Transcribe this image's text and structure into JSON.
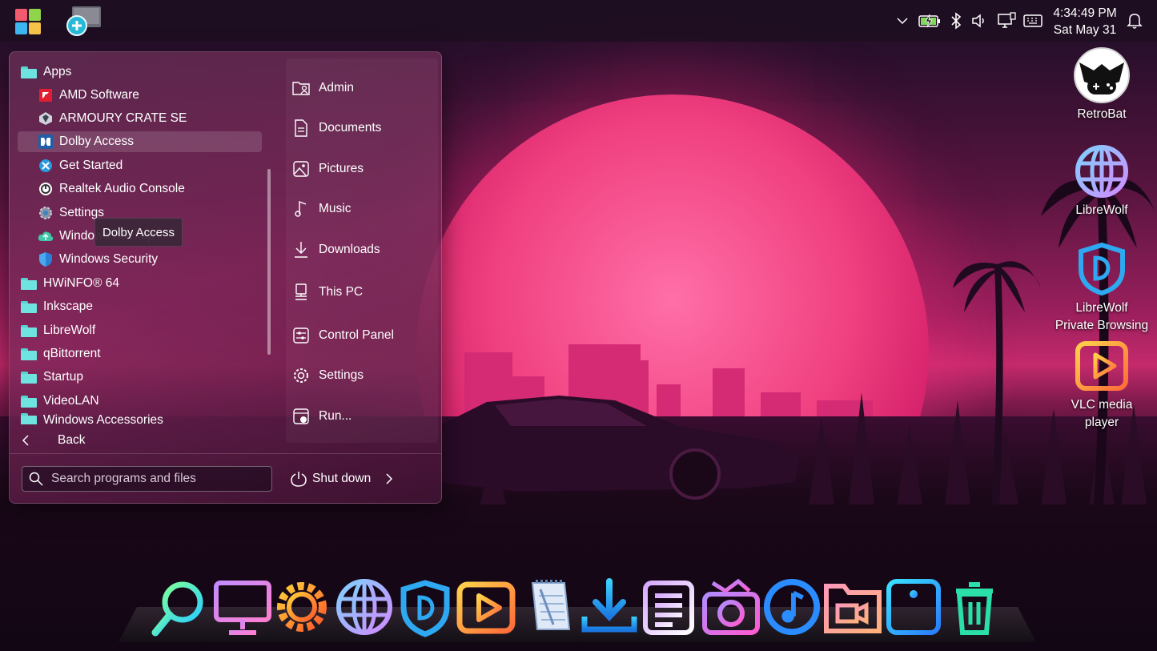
{
  "taskbar": {
    "start_icon": "windows-logo-icon",
    "pinned_app_icon": "magnifier-app-icon",
    "tray_icons": [
      "chevron-up-icon",
      "battery-charging-icon",
      "bluetooth-icon",
      "volume-icon",
      "display-icon",
      "keyboard-icon"
    ],
    "clock": {
      "time": "4:34:49 PM",
      "date": "Sat May 31"
    },
    "notification_icon": "bell-icon"
  },
  "start_menu": {
    "tree": [
      {
        "type": "folder",
        "label": "Apps"
      },
      {
        "type": "app",
        "label": "AMD Software",
        "icon": "amd-icon"
      },
      {
        "type": "app",
        "label": "ARMOURY CRATE SE",
        "icon": "armoury-crate-icon"
      },
      {
        "type": "app",
        "label": "Dolby Access",
        "icon": "dolby-icon",
        "selected": true
      },
      {
        "type": "app",
        "label": "Get Started",
        "icon": "get-started-icon"
      },
      {
        "type": "app",
        "label": "Realtek Audio Console",
        "icon": "realtek-icon"
      },
      {
        "type": "app",
        "label": "Settings",
        "icon": "settings-gear-icon"
      },
      {
        "type": "app",
        "label": "Windows Backup",
        "icon": "backup-cloud-icon"
      },
      {
        "type": "app",
        "label": "Windows Security",
        "icon": "shield-icon"
      },
      {
        "type": "folder",
        "label": "HWiNFO® 64"
      },
      {
        "type": "folder",
        "label": "Inkscape"
      },
      {
        "type": "folder",
        "label": "LibreWolf"
      },
      {
        "type": "folder",
        "label": "qBittorrent"
      },
      {
        "type": "folder",
        "label": "Startup"
      },
      {
        "type": "folder",
        "label": "VideoLAN"
      },
      {
        "type": "folder",
        "label": "Windows Accessories"
      }
    ],
    "tooltip": "Dolby Access",
    "back_label": "Back",
    "places": [
      {
        "label": "Admin",
        "icon": "user-folder-icon"
      },
      {
        "label": "Documents",
        "icon": "document-icon"
      },
      {
        "label": "Pictures",
        "icon": "picture-icon"
      },
      {
        "label": "Music",
        "icon": "music-note-icon"
      },
      {
        "label": "Downloads",
        "icon": "download-icon"
      },
      {
        "label": "This PC",
        "icon": "computer-icon"
      },
      {
        "label": "Control Panel",
        "icon": "control-panel-icon"
      },
      {
        "label": "Settings",
        "icon": "gear-icon"
      },
      {
        "label": "Run...",
        "icon": "run-icon"
      }
    ],
    "search_placeholder": "Search programs and files",
    "shutdown_label": "Shut down"
  },
  "desktop_icons": [
    {
      "label": "RetroBat",
      "icon": "retrobat-icon"
    },
    {
      "label": "LibreWolf",
      "icon": "globe-icon"
    },
    {
      "label": "LibreWolf\nPrivate Browsing",
      "line1": "LibreWolf",
      "line2": "Private Browsing",
      "icon": "private-shield-icon"
    },
    {
      "label": "VLC media player",
      "line1": "VLC media",
      "line2": "player",
      "icon": "play-icon"
    }
  ],
  "dock": [
    "search-icon",
    "monitor-icon",
    "gear-icon",
    "globe-icon",
    "shield-icon",
    "play-icon",
    "notepad-icon",
    "download-icon",
    "document-list-icon",
    "camera-icon",
    "music-icon",
    "video-folder-icon",
    "info-icon",
    "trash-icon"
  ],
  "colors": {
    "accent_pink": "#e8317a",
    "wallpaper_sun": "#f0407f",
    "folder_teal": "#6fe3df"
  }
}
